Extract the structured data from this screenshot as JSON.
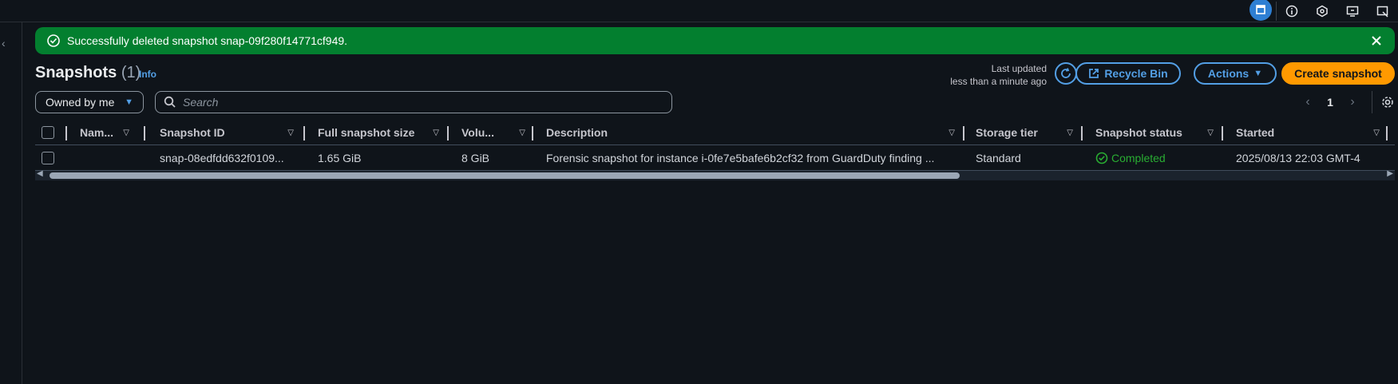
{
  "flash": {
    "message": "Successfully deleted snapshot snap-09f280f14771cf949."
  },
  "header": {
    "title": "Snapshots",
    "count": "(1)",
    "info": "Info",
    "last_updated_line1": "Last updated",
    "last_updated_line2": "less than a minute ago",
    "recycle_bin": "Recycle Bin",
    "actions": "Actions",
    "create": "Create snapshot"
  },
  "filters": {
    "owned_by": "Owned by me",
    "search_placeholder": "Search"
  },
  "pager": {
    "page": "1"
  },
  "table": {
    "columns": [
      "Nam...",
      "Snapshot ID",
      "Full snapshot size",
      "Volu...",
      "Description",
      "Storage tier",
      "Snapshot status",
      "Started"
    ],
    "rows": [
      {
        "name": "",
        "snapshot_id": "snap-08edfdd632f0109...",
        "size": "1.65 GiB",
        "volume": "8 GiB",
        "description": "Forensic snapshot for instance i-0fe7e5bafe6b2cf32 from GuardDuty finding ...",
        "storage_tier": "Standard",
        "status": "Completed",
        "started": "2025/08/13 22:03 GMT-4"
      }
    ]
  },
  "colors": {
    "success": "#037f2f",
    "link": "#539fe5",
    "primary": "#ff9900",
    "status_ok": "#29ad32"
  }
}
